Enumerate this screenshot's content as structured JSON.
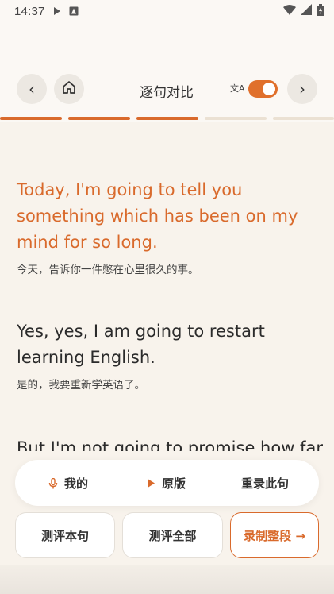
{
  "status_bar": {
    "time": "14:37"
  },
  "nav": {
    "title": "逐句对比",
    "back_icon": "‹",
    "forward_icon": "›",
    "translate_icon": "文A",
    "translation_toggle_on": true
  },
  "progress": {
    "segments_total": 5,
    "segments_done": 3,
    "accent": "#d96a2c"
  },
  "sentences": [
    {
      "en": "Today, I'm going to tell you something which has been on my mind for so long.",
      "zh": "今天，告诉你一件憋在心里很久的事。",
      "active": true
    },
    {
      "en": "Yes, yes, I am going to restart learning English.",
      "zh": "是的，我要重新学英语了。",
      "active": false
    },
    {
      "en": "But I'm not going to promise how far",
      "zh": "",
      "active": false
    }
  ],
  "playback": {
    "mine": "我的",
    "original": "原版",
    "rerecord": "重录此句"
  },
  "actions": {
    "evaluate_sentence": "测评本句",
    "evaluate_all": "测评全部",
    "record_paragraph": "录制整段 →"
  },
  "colors": {
    "accent": "#d96a2c",
    "background": "#f8f3ec"
  }
}
